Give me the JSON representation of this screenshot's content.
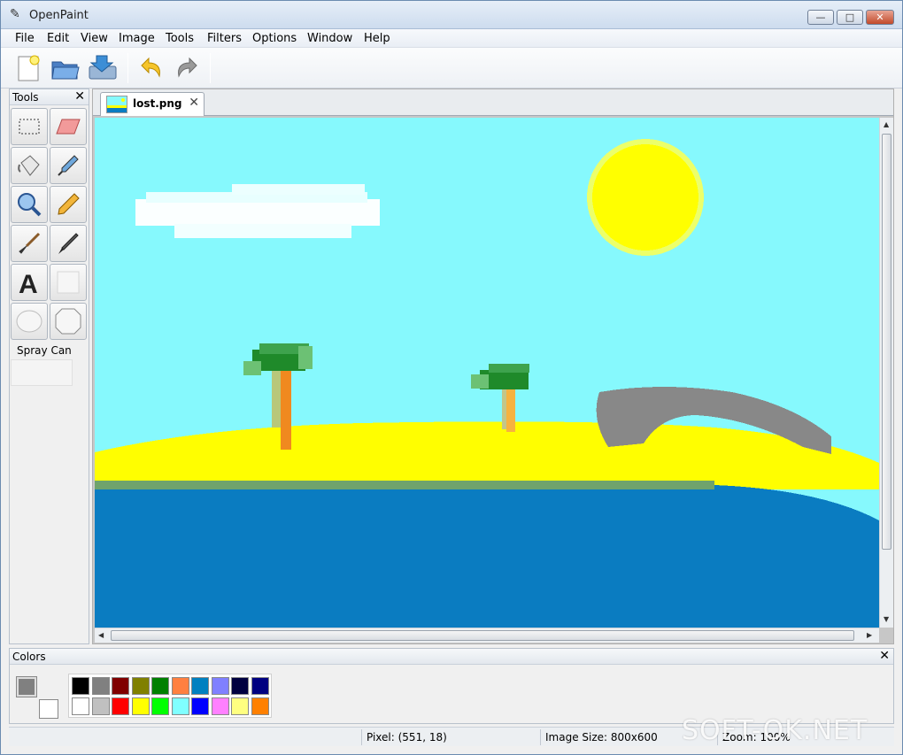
{
  "window": {
    "title": "OpenPaint"
  },
  "menu": [
    "File",
    "Edit",
    "View",
    "Image",
    "Tools",
    "Filters",
    "Options",
    "Window",
    "Help"
  ],
  "toolbar": {
    "buttons": [
      "new-document",
      "open-file",
      "save-file",
      "undo",
      "redo"
    ]
  },
  "tools_panel": {
    "title": "Tools",
    "tools": [
      "rectangle-select",
      "eraser",
      "paint-bucket",
      "color-picker",
      "zoom",
      "pencil",
      "paintbrush",
      "clone-stamp",
      "text",
      "rectangle",
      "ellipse",
      "rounded-rectangle"
    ],
    "current_tool_name": "Spray Can"
  },
  "document": {
    "tab_label": "lost.png"
  },
  "colors_panel": {
    "title": "Colors",
    "primary_color": "#808080",
    "secondary_color": "#ffffff",
    "palette_row1": [
      "#000000",
      "#808080",
      "#800000",
      "#808000",
      "#008000",
      "#ff8040",
      "#0080c0",
      "#8080ff",
      "#000040",
      "#000080"
    ],
    "palette_row2": [
      "#ffffff",
      "#c0c0c0",
      "#ff0000",
      "#ffff00",
      "#00ff00",
      "#80ffff",
      "#0000ff",
      "#ff80ff",
      "#ffff80",
      "#ff8000"
    ]
  },
  "status": {
    "pixel": "Pixel: (551, 18)",
    "image_size": "Image Size: 800x600",
    "zoom": "Zoom: 100%"
  },
  "watermark": "SOFT-OK.NET"
}
